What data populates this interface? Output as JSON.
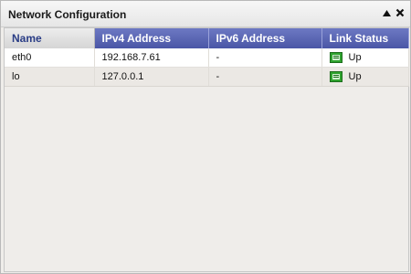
{
  "window": {
    "title": "Network Configuration",
    "collapse_icon": "collapse-up-icon",
    "close_icon": "close-icon"
  },
  "table": {
    "columns": [
      "Name",
      "IPv4 Address",
      "IPv6 Address",
      "Link Status"
    ],
    "rows": [
      {
        "name": "eth0",
        "ipv4": "192.168.7.61",
        "ipv6": "-",
        "status": "Up",
        "status_icon": "network-link-icon"
      },
      {
        "name": "lo",
        "ipv4": "127.0.0.1",
        "ipv6": "-",
        "status": "Up",
        "status_icon": "network-link-icon"
      }
    ]
  },
  "colors": {
    "header_accent": "#4a56a6",
    "status_up": "#2fa32f"
  }
}
